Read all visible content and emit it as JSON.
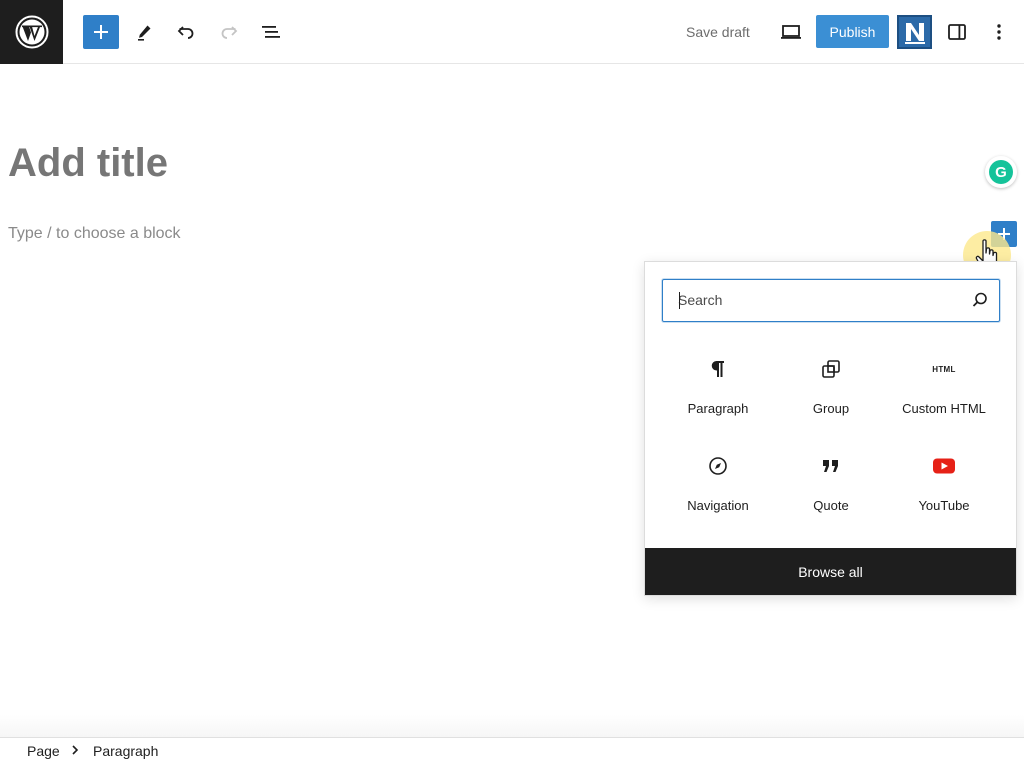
{
  "toolbar": {
    "save_draft_label": "Save draft",
    "publish_label": "Publish",
    "n_logo_letter": "N"
  },
  "editor": {
    "title_placeholder": "Add title",
    "block_prompt": "Type / to choose a block"
  },
  "grammarly": {
    "letter": "G"
  },
  "inserter": {
    "search_placeholder": "Search",
    "blocks": [
      {
        "label": "Paragraph",
        "icon": "paragraph-icon"
      },
      {
        "label": "Group",
        "icon": "group-icon"
      },
      {
        "label": "Custom HTML",
        "icon": "html-icon",
        "icon_text": "HTML"
      },
      {
        "label": "Navigation",
        "icon": "navigation-icon"
      },
      {
        "label": "Quote",
        "icon": "quote-icon"
      },
      {
        "label": "YouTube",
        "icon": "youtube-icon"
      }
    ],
    "browse_all_label": "Browse all"
  },
  "breadcrumb": {
    "items": [
      "Page",
      "Paragraph"
    ]
  },
  "colors": {
    "accent": "#2f7fc8",
    "publish": "#3b8fd4",
    "dark": "#1e1e1e",
    "youtube": "#e62117",
    "grammarly": "#15c39a"
  }
}
